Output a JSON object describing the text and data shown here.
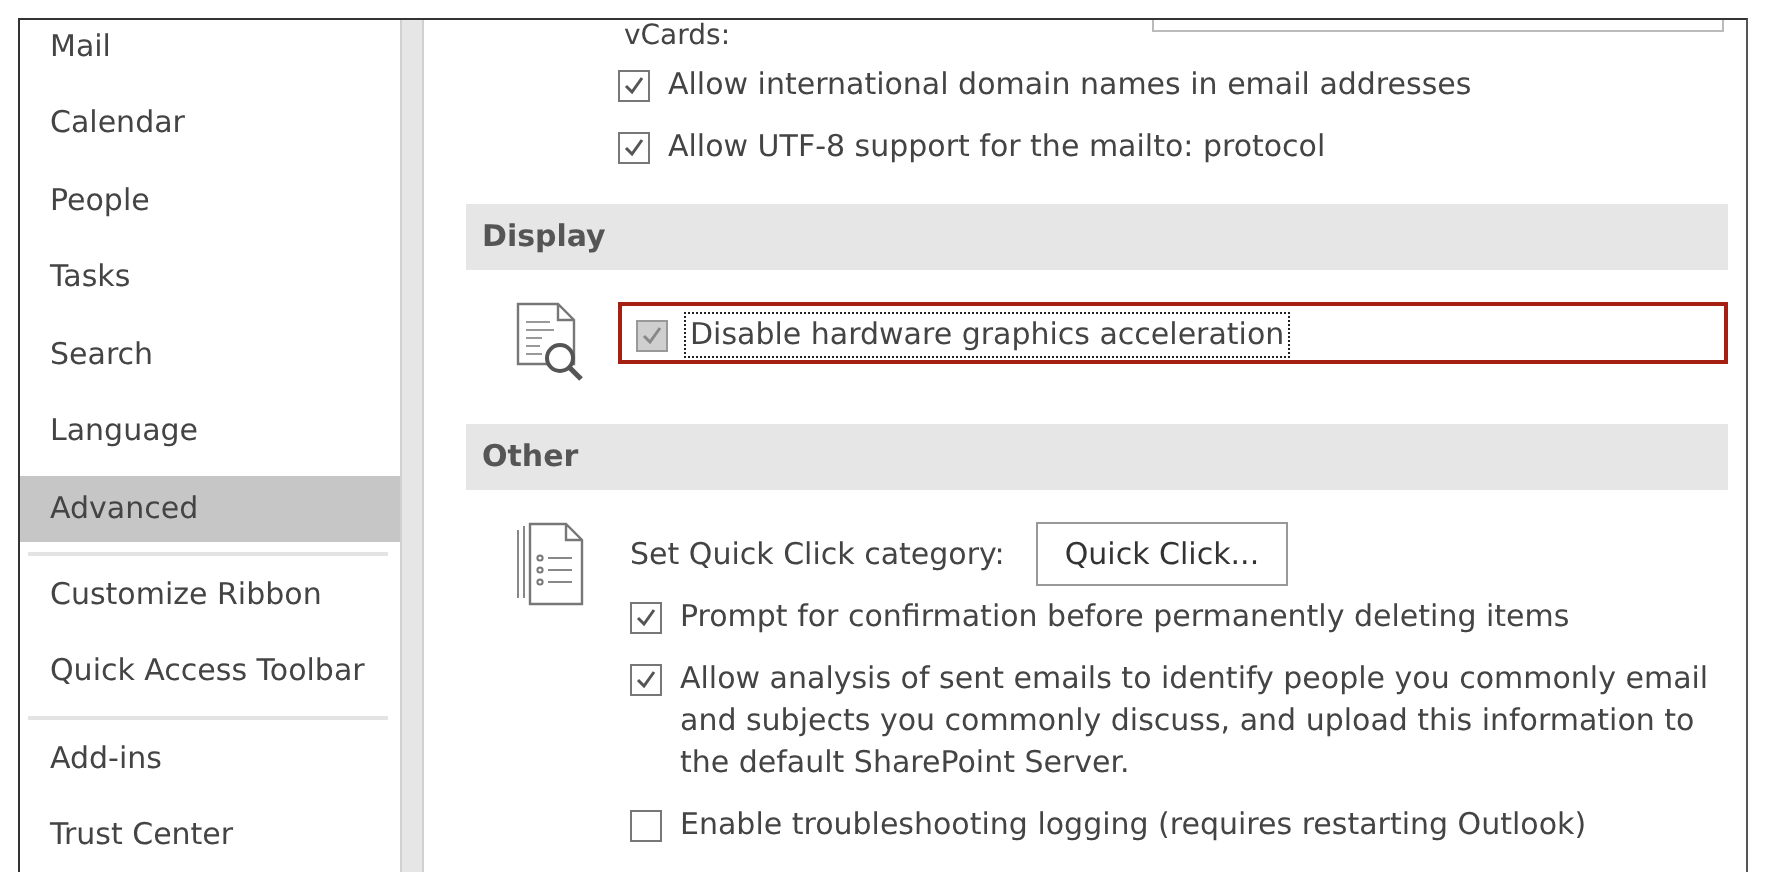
{
  "sidebar": {
    "groups": [
      [
        {
          "label": "Mail",
          "selected": false
        },
        {
          "label": "Calendar",
          "selected": false
        },
        {
          "label": "People",
          "selected": false
        },
        {
          "label": "Tasks",
          "selected": false
        },
        {
          "label": "Search",
          "selected": false
        },
        {
          "label": "Language",
          "selected": false
        },
        {
          "label": "Advanced",
          "selected": true
        }
      ],
      [
        {
          "label": "Customize Ribbon",
          "selected": false
        },
        {
          "label": "Quick Access Toolbar",
          "selected": false
        }
      ],
      [
        {
          "label": "Add-ins",
          "selected": false
        },
        {
          "label": "Trust Center",
          "selected": false
        }
      ]
    ]
  },
  "top": {
    "label": "vCards:",
    "options": [
      {
        "kind": "checkbox",
        "label": "Allow international domain names in email addresses",
        "checked": true,
        "disabled": false,
        "highlighted": false
      },
      {
        "kind": "checkbox",
        "label": "Allow UTF-8 support for the mailto: protocol",
        "checked": true,
        "disabled": false,
        "highlighted": false
      }
    ]
  },
  "sections": [
    {
      "title": "Display",
      "rows": [
        {
          "kind": "checkbox",
          "label": "Disable hardware graphics acceleration",
          "checked": true,
          "disabled": true,
          "highlighted": true
        }
      ]
    },
    {
      "title": "Other",
      "rows": [
        {
          "kind": "button_row",
          "label": "Set Quick Click category:",
          "button": "Quick Click..."
        },
        {
          "kind": "checkbox",
          "label": "Prompt for confirmation before permanently deleting items",
          "checked": true,
          "disabled": false,
          "highlighted": false
        },
        {
          "kind": "checkbox",
          "label": "Allow analysis of sent emails to identify people you commonly email and subjects you commonly discuss, and upload this information to the default SharePoint Server.",
          "checked": true,
          "disabled": false,
          "highlighted": false
        },
        {
          "kind": "checkbox",
          "label": "Enable troubleshooting logging (requires restarting Outlook)",
          "checked": false,
          "disabled": false,
          "highlighted": false
        }
      ]
    }
  ]
}
